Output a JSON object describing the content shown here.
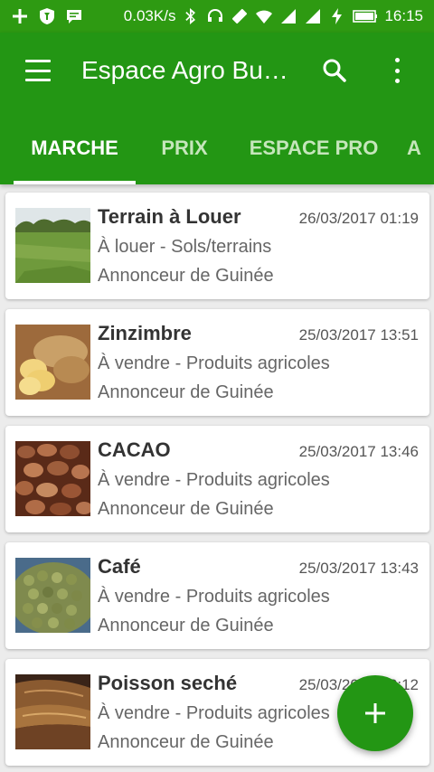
{
  "status_bar": {
    "network_speed": "0.03K/s",
    "time": "16:15",
    "icons": [
      "plus-icon",
      "shield-icon",
      "message-icon",
      "bluetooth-icon",
      "headphones-icon",
      "vibrate-icon",
      "wifi-icon",
      "signal-icon",
      "signal-icon",
      "charging-icon",
      "battery-icon"
    ]
  },
  "app_bar": {
    "title": "Espace Agro Bu…",
    "color": "#239614"
  },
  "tabs": [
    {
      "label": "MARCHE",
      "active": true
    },
    {
      "label": "PRIX",
      "active": false
    },
    {
      "label": "ESPACE PRO",
      "active": false
    },
    {
      "label": "A",
      "active": false
    }
  ],
  "listings": [
    {
      "title": "Terrain à Louer",
      "date": "26/03/2017 01:19",
      "category": "À louer - Sols/terrains",
      "seller": "Annonceur de Guinée",
      "image": "field-photo"
    },
    {
      "title": "Zinzimbre",
      "date": "25/03/2017 13:51",
      "category": "À vendre - Produits agricoles",
      "seller": "Annonceur de Guinée",
      "image": "ginger-photo"
    },
    {
      "title": "CACAO",
      "date": "25/03/2017 13:46",
      "category": "À vendre - Produits agricoles",
      "seller": "Annonceur de Guinée",
      "image": "cocoa-beans-photo"
    },
    {
      "title": "Café",
      "date": "25/03/2017 13:43",
      "category": "À vendre - Produits agricoles",
      "seller": "Annonceur de Guinée",
      "image": "coffee-beans-photo"
    },
    {
      "title": "Poisson seché",
      "date": "25/03/2017 13:12",
      "category": "À vendre - Produits agricoles",
      "seller": "Annonceur de Guinée",
      "image": "dried-fish-photo"
    }
  ],
  "fab": {
    "icon": "plus-icon"
  }
}
